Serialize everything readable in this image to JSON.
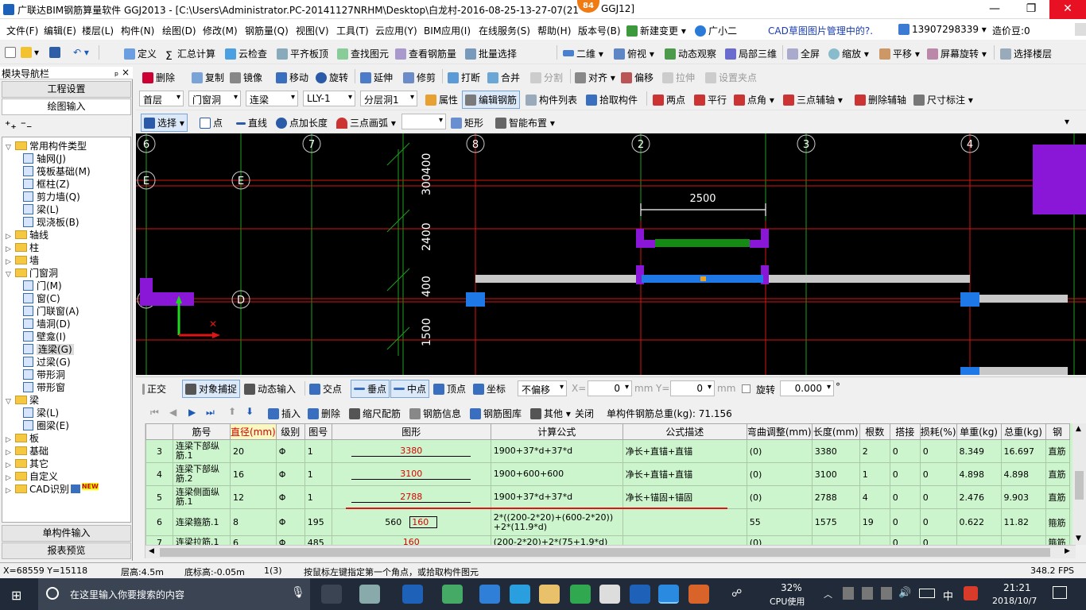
{
  "window": {
    "title": "广联达BIM钢筋算量软件 GGJ2013 - [C:\\Users\\Administrator.PC-20141127NRHM\\Desktop\\白龙村-2016-08-25-13-27-07(21",
    "title_tail": "GGJ12]",
    "badge": "84",
    "min": "—",
    "max": "❐",
    "close": "✕"
  },
  "menu": [
    "文件(F)",
    "编辑(E)",
    "楼层(L)",
    "构件(N)",
    "绘图(D)",
    "修改(M)",
    "钢筋量(Q)",
    "视图(V)",
    "工具(T)",
    "云应用(Y)",
    "BIM应用(I)",
    "在线服务(S)",
    "帮助(H)",
    "版本号(B)",
    "新建变更",
    "广小二",
    "CAD草图图片管理中的?.",
    "13907298339",
    "造价豆:0"
  ],
  "toolbar1": [
    "定义",
    "汇总计算",
    "云检查",
    "平齐板顶",
    "查找图元",
    "查看钢筋量",
    "批量选择",
    "二维",
    "俯视",
    "动态观察",
    "局部三维",
    "全屏",
    "缩放",
    "平移",
    "屏幕旋转",
    "选择楼层"
  ],
  "toolbar2": [
    "删除",
    "复制",
    "镜像",
    "移动",
    "旋转",
    "延伸",
    "修剪",
    "打断",
    "合并",
    "分割",
    "对齐",
    "偏移",
    "拉伸",
    "设置夹点"
  ],
  "toolbar3": {
    "floor": "首层",
    "type": "门窗洞",
    "sub": "连梁",
    "name": "LLY-1",
    "layer": "分层洞1",
    "items": [
      "属性",
      "编辑钢筋",
      "构件列表",
      "拾取构件",
      "两点",
      "平行",
      "点角",
      "三点辅轴",
      "删除辅轴",
      "尺寸标注"
    ]
  },
  "toolbar4": [
    "选择",
    "点",
    "直线",
    "点加长度",
    "三点画弧",
    "矩形",
    "智能布置"
  ],
  "leftpanel": {
    "header": "模块导航栏",
    "pin": "ₚ ×",
    "btn_engineering": "工程设置",
    "btn_draw": "绘图输入",
    "btn_single": "单构件输入",
    "btn_report": "报表预览",
    "tree": [
      {
        "lvl": 0,
        "exp": "▽",
        "type": "folder",
        "label": "常用构件类型"
      },
      {
        "lvl": 1,
        "type": "comp",
        "label": "轴网(J)"
      },
      {
        "lvl": 1,
        "type": "comp",
        "label": "筏板基础(M)"
      },
      {
        "lvl": 1,
        "type": "comp",
        "label": "框柱(Z)"
      },
      {
        "lvl": 1,
        "type": "comp",
        "label": "剪力墙(Q)"
      },
      {
        "lvl": 1,
        "type": "comp",
        "label": "梁(L)"
      },
      {
        "lvl": 1,
        "type": "comp",
        "label": "现浇板(B)"
      },
      {
        "lvl": 0,
        "exp": "▷",
        "type": "folder",
        "label": "轴线"
      },
      {
        "lvl": 0,
        "exp": "▷",
        "type": "folder",
        "label": "柱"
      },
      {
        "lvl": 0,
        "exp": "▷",
        "type": "folder",
        "label": "墙"
      },
      {
        "lvl": 0,
        "exp": "▽",
        "type": "folder",
        "label": "门窗洞"
      },
      {
        "lvl": 1,
        "type": "comp",
        "label": "门(M)"
      },
      {
        "lvl": 1,
        "type": "comp",
        "label": "窗(C)"
      },
      {
        "lvl": 1,
        "type": "comp",
        "label": "门联窗(A)"
      },
      {
        "lvl": 1,
        "type": "comp",
        "label": "墙洞(D)"
      },
      {
        "lvl": 1,
        "type": "comp",
        "label": "壁龛(I)"
      },
      {
        "lvl": 1,
        "type": "comp",
        "label": "连梁(G)",
        "selected": true
      },
      {
        "lvl": 1,
        "type": "comp",
        "label": "过梁(G)"
      },
      {
        "lvl": 1,
        "type": "comp",
        "label": "带形洞"
      },
      {
        "lvl": 1,
        "type": "comp",
        "label": "带形窗"
      },
      {
        "lvl": 0,
        "exp": "▽",
        "type": "folder",
        "label": "梁"
      },
      {
        "lvl": 1,
        "type": "comp",
        "label": "梁(L)"
      },
      {
        "lvl": 1,
        "type": "comp",
        "label": "圈梁(E)"
      },
      {
        "lvl": 0,
        "exp": "▷",
        "type": "folder",
        "label": "板"
      },
      {
        "lvl": 0,
        "exp": "▷",
        "type": "folder",
        "label": "基础"
      },
      {
        "lvl": 0,
        "exp": "▷",
        "type": "folder",
        "label": "其它"
      },
      {
        "lvl": 0,
        "exp": "▷",
        "type": "folder",
        "label": "自定义"
      },
      {
        "lvl": 0,
        "exp": "▷",
        "type": "folder",
        "label": "CAD识别",
        "new": "NEW"
      }
    ]
  },
  "cad": {
    "axis_top": [
      "6",
      "7",
      "8",
      "2",
      "3",
      "4"
    ],
    "axis_left": [
      "E",
      "D"
    ],
    "dims_v": [
      "300400",
      "2400",
      "400",
      "1500"
    ],
    "dim_h": "2500"
  },
  "snapbar": {
    "items": [
      "正交",
      "对象捕捉",
      "动态输入",
      "交点",
      "垂点",
      "中点",
      "顶点",
      "坐标"
    ],
    "offset": "不偏移",
    "x_label": "X=",
    "x_val": "0",
    "y_label": "Y=",
    "y_val": "0",
    "unit": "mm",
    "rotate_label": "旋转",
    "rotate_val": "0.000",
    "deg": "°"
  },
  "rebarbar": {
    "items": [
      "插入",
      "删除",
      "缩尺配筋",
      "钢筋信息",
      "钢筋图库",
      "其他",
      "关闭"
    ],
    "total": "单构件钢筋总重(kg): 71.156"
  },
  "grid": {
    "headers": [
      "",
      "筋号",
      "直径(mm)",
      "级别",
      "图号",
      "图形",
      "计算公式",
      "公式描述",
      "弯曲调整(mm)",
      "长度(mm)",
      "根数",
      "搭接",
      "损耗(%)",
      "单重(kg)",
      "总重(kg)",
      "钢"
    ],
    "rows": [
      {
        "no": "3",
        "name": "连梁下部纵筋.1",
        "dia": "20",
        "grade": "Φ",
        "fig": "1",
        "shape": "3380",
        "formula": "1900+37*d+37*d",
        "desc": "净长+直锚+直锚",
        "bend": "(0)",
        "len": "3380",
        "cnt": "2",
        "lap": "0",
        "loss": "0",
        "unit": "8.349",
        "total": "16.697",
        "type": "直筋"
      },
      {
        "no": "4",
        "name": "连梁下部纵筋.2",
        "dia": "16",
        "grade": "Φ",
        "fig": "1",
        "shape": "3100",
        "formula": "1900+600+600",
        "desc": "净长+直锚+直锚",
        "bend": "(0)",
        "len": "3100",
        "cnt": "1",
        "lap": "0",
        "loss": "0",
        "unit": "4.898",
        "total": "4.898",
        "type": "直筋"
      },
      {
        "no": "5",
        "name": "连梁侧面纵筋.1",
        "dia": "12",
        "grade": "Φ",
        "fig": "1",
        "shape": "2788",
        "formula": "1900+37*d+37*d",
        "desc": "净长+锚固+锚固",
        "bend": "(0)",
        "len": "2788",
        "cnt": "4",
        "lap": "0",
        "loss": "0",
        "unit": "2.476",
        "total": "9.903",
        "type": "直筋"
      },
      {
        "no": "6",
        "name": "连梁箍筋.1",
        "dia": "8",
        "grade": "Φ",
        "fig": "195",
        "shape_a": "560",
        "shape_b": "160",
        "formula": "2*((200-2*20)+(600-2*20))+2*(11.9*d)",
        "desc": "",
        "bend": "55",
        "len": "1575",
        "cnt": "19",
        "lap": "0",
        "loss": "0",
        "unit": "0.622",
        "total": "11.82",
        "type": "箍筋"
      },
      {
        "no": "7",
        "name": "连梁拉筋.1",
        "dia": "6",
        "grade": "Φ",
        "fig": "485",
        "shape": "160",
        "formula": "(200-2*20)+2*(75+1.9*d)",
        "desc": "",
        "bend": "(0)",
        "len": "",
        "cnt": "",
        "lap": "0",
        "loss": "0",
        "unit": "",
        "total": "",
        "type": "箍筋"
      }
    ]
  },
  "status": {
    "coords": "X=68559 Y=15118",
    "floor_h": "层高:4.5m",
    "base_h": "底标高:-0.05m",
    "count": "1(3)",
    "hint": "按鼠标左键指定第一个角点，或拾取构件图元",
    "fps": "348.2 FPS"
  },
  "taskbar": {
    "search": "在这里输入你要搜索的内容",
    "cpu_pct": "32%",
    "cpu_label": "CPU使用",
    "ime": "中",
    "time": "21:21",
    "date": "2018/10/7"
  }
}
